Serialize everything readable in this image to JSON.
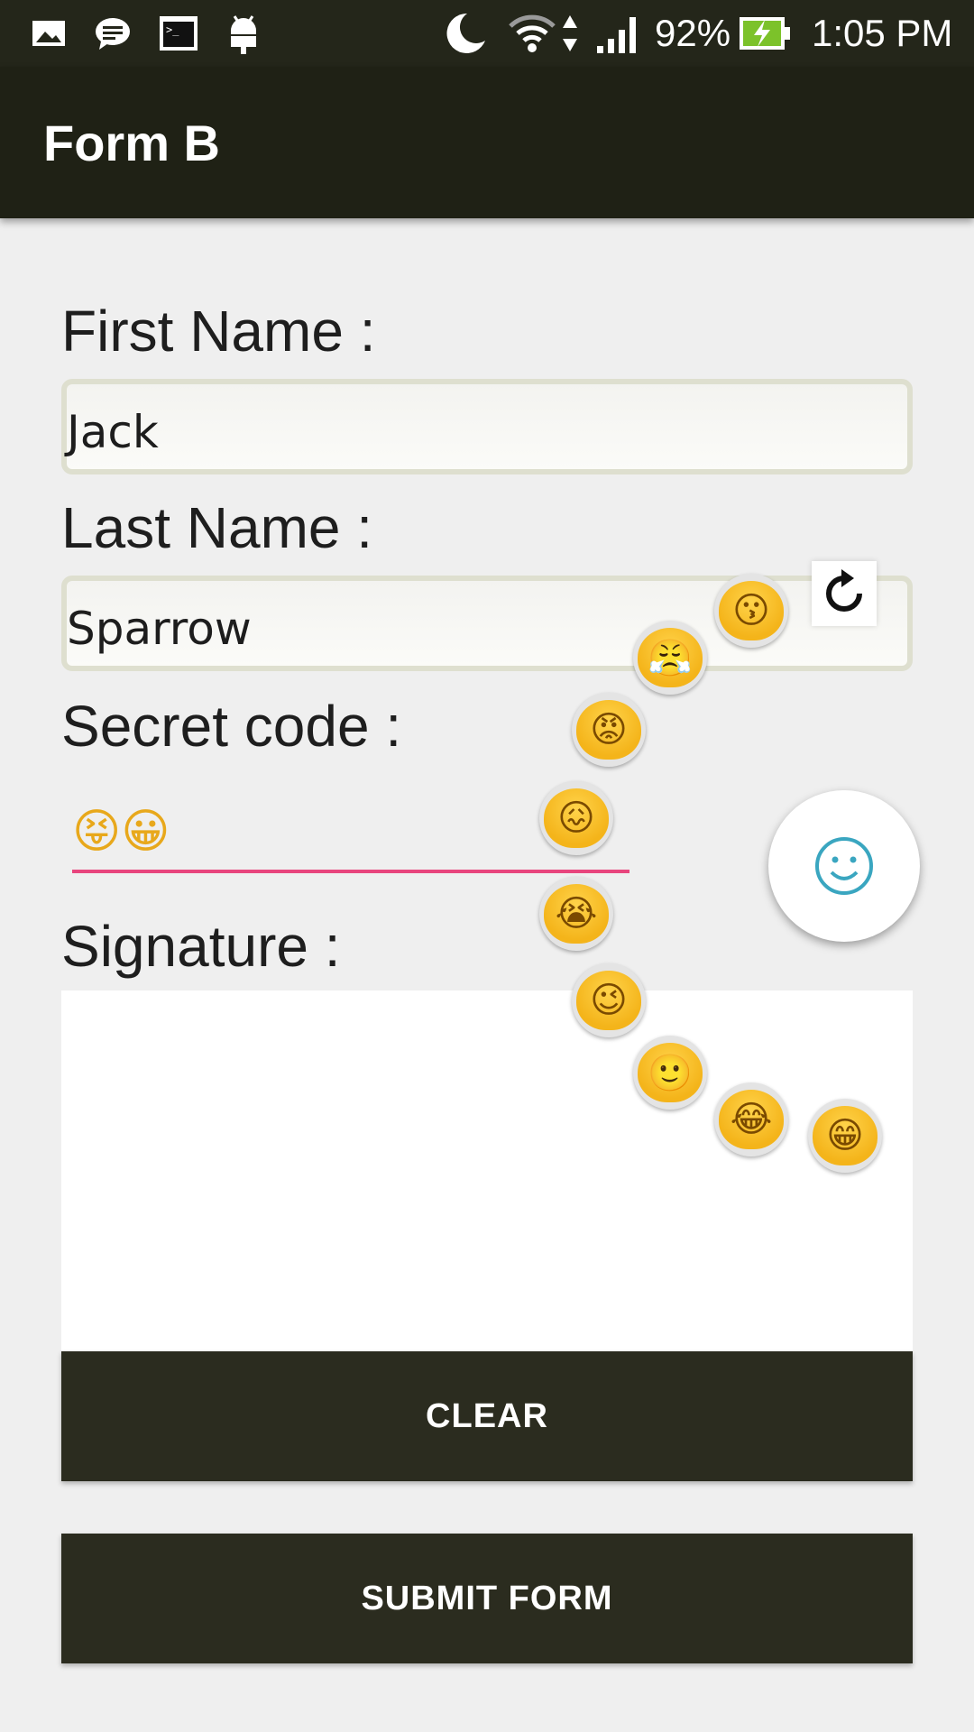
{
  "status_bar": {
    "battery": "92%",
    "time": "1:05 PM",
    "icons": [
      "image-icon",
      "message-icon",
      "terminal-icon",
      "android-icon",
      "moon-icon",
      "wifi-icon",
      "data-arrows-icon",
      "signal-icon",
      "battery-charging-icon"
    ]
  },
  "appbar": {
    "title": "Form B"
  },
  "form": {
    "first_name_label": "First Name :",
    "first_name_value": "Jack",
    "last_name_label": "Last Name :",
    "last_name_value": "Sparrow",
    "secret_code_label": "Secret code :",
    "secret_code_value": "😝😀",
    "signature_label": "Signature :"
  },
  "buttons": {
    "clear": "CLEAR",
    "submit": "SUBMIT FORM"
  },
  "emoji_menu": {
    "items": [
      "😗",
      "😤",
      "😡",
      "😖",
      "😭",
      "😉",
      "🙂",
      "😂",
      "😁"
    ],
    "refresh_icon": "refresh-icon",
    "fab_icon": "smiley-icon"
  },
  "colors": {
    "appbar": "#1f2115",
    "accent_underline": "#e8457d",
    "button": "#2b2c1f",
    "fab_icon": "#3aa6c0"
  }
}
